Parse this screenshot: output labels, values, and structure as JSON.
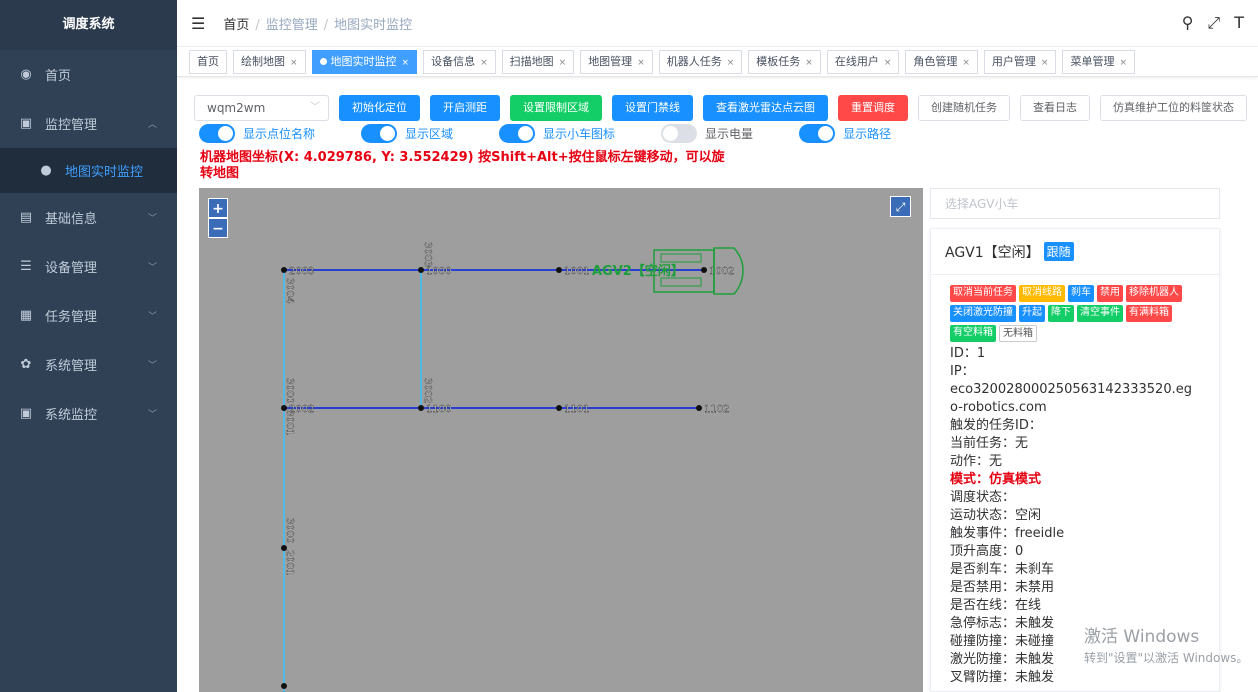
{
  "app": {
    "title": "调度系统"
  },
  "sidebar": {
    "items": [
      {
        "label": "首页",
        "icon": "dashboard-icon"
      },
      {
        "label": "监控管理",
        "icon": "monitor-icon",
        "expanded": true
      },
      {
        "label": "地图实时监控",
        "icon": "globe-icon",
        "active": true
      },
      {
        "label": "基础信息",
        "icon": "document-icon"
      },
      {
        "label": "设备管理",
        "icon": "list-icon"
      },
      {
        "label": "任务管理",
        "icon": "task-icon"
      },
      {
        "label": "系统管理",
        "icon": "gear-icon"
      },
      {
        "label": "系统监控",
        "icon": "monitor-icon"
      }
    ]
  },
  "breadcrumb": {
    "home": "首页",
    "level1": "监控管理",
    "level2": "地图实时监控"
  },
  "tags": [
    {
      "label": "首页"
    },
    {
      "label": "绘制地图"
    },
    {
      "label": "地图实时监控",
      "active": true
    },
    {
      "label": "设备信息"
    },
    {
      "label": "扫描地图"
    },
    {
      "label": "地图管理"
    },
    {
      "label": "机器人任务"
    },
    {
      "label": "模板任务"
    },
    {
      "label": "在线用户"
    },
    {
      "label": "角色管理"
    },
    {
      "label": "用户管理"
    },
    {
      "label": "菜单管理"
    }
  ],
  "toolbar": {
    "map_select": "wqm2wm",
    "init_position": "初始化定位",
    "start_test": "开启测距",
    "set_limit_area": "设置限制区域",
    "set_door_ban": "设置门禁线",
    "view_laser": "查看激光雷达点云图",
    "reset_dispatch": "重置调度",
    "create_random_task": "创建随机任务",
    "view_log": "查看日志",
    "simulate_status": "仿真维护工位的料筐状态"
  },
  "switches": {
    "show_point_name": "显示点位名称",
    "show_area": "显示区域",
    "show_car_icon": "显示小车图标",
    "show_battery": "显示电量",
    "show_path": "显示路径"
  },
  "coord_text": "机器地图坐标(X: 4.029786, Y: 3.552429) 按Shift+Alt+按住鼠标左键移动，可以旋转地图",
  "map": {
    "background": "#9e9e9e",
    "path_color": "#2a3fcf",
    "vertical_color": "#52b8e6",
    "points": {
      "p2003": "2003",
      "p1000": "1000",
      "p1001": "1001",
      "p1002": "1002",
      "p2002": "2002",
      "p1100": "1100",
      "p1101": "1101",
      "p1102": "1102"
    },
    "edges": {
      "e3003": "3003",
      "e3004": "3004",
      "e3002": "3002",
      "e3000": "3000",
      "e3001": "3001",
      "e2001": "2001"
    },
    "agv_label": "AGV2【空闲】"
  },
  "panel": {
    "select_placeholder": "选择AGV小车",
    "agv_title": "AGV1【空闲】",
    "follow": "跟随",
    "actions": [
      {
        "label": "取消当前任务",
        "color": "r"
      },
      {
        "label": "取消线路",
        "color": "y"
      },
      {
        "label": "刹车",
        "color": "b"
      },
      {
        "label": "禁用",
        "color": "r"
      },
      {
        "label": "移除机器人",
        "color": "r"
      },
      {
        "label": "关闭激光防撞",
        "color": "b"
      },
      {
        "label": "升起",
        "color": "b"
      },
      {
        "label": "降下",
        "color": "g"
      },
      {
        "label": "清空事件",
        "color": "g"
      },
      {
        "label": "有满料箱",
        "color": "r"
      },
      {
        "label": "有空料箱",
        "color": "g"
      },
      {
        "label": "无料箱",
        "color": "w"
      }
    ],
    "info": {
      "id": "ID：1",
      "ip_label": "IP：",
      "ip_value": "eco32002800025056314233352​0.ego-robotics.com",
      "trigger_task": "触发的任务ID：",
      "current_task": "当前任务：无",
      "action": "动作：无",
      "mode": "模式：仿真模式",
      "dispatch_state": "调度状态：",
      "motion_state": "运动状态：空闲",
      "trigger_event": "触发事件：freeidle",
      "lift_height": "顶升高度：0",
      "brake": "是否刹车：未刹车",
      "disabled": "是否禁用：未禁用",
      "online": "是否在线：在线",
      "estop": "急停标志：未触发",
      "collision": "碰撞防撞：未碰撞",
      "laser": "激光防撞：未触发",
      "fork": "叉臂防撞：未触发"
    }
  },
  "watermark": {
    "line1": "激活 Windows",
    "line2": "转到\"设置\"以激活 Windows。"
  }
}
